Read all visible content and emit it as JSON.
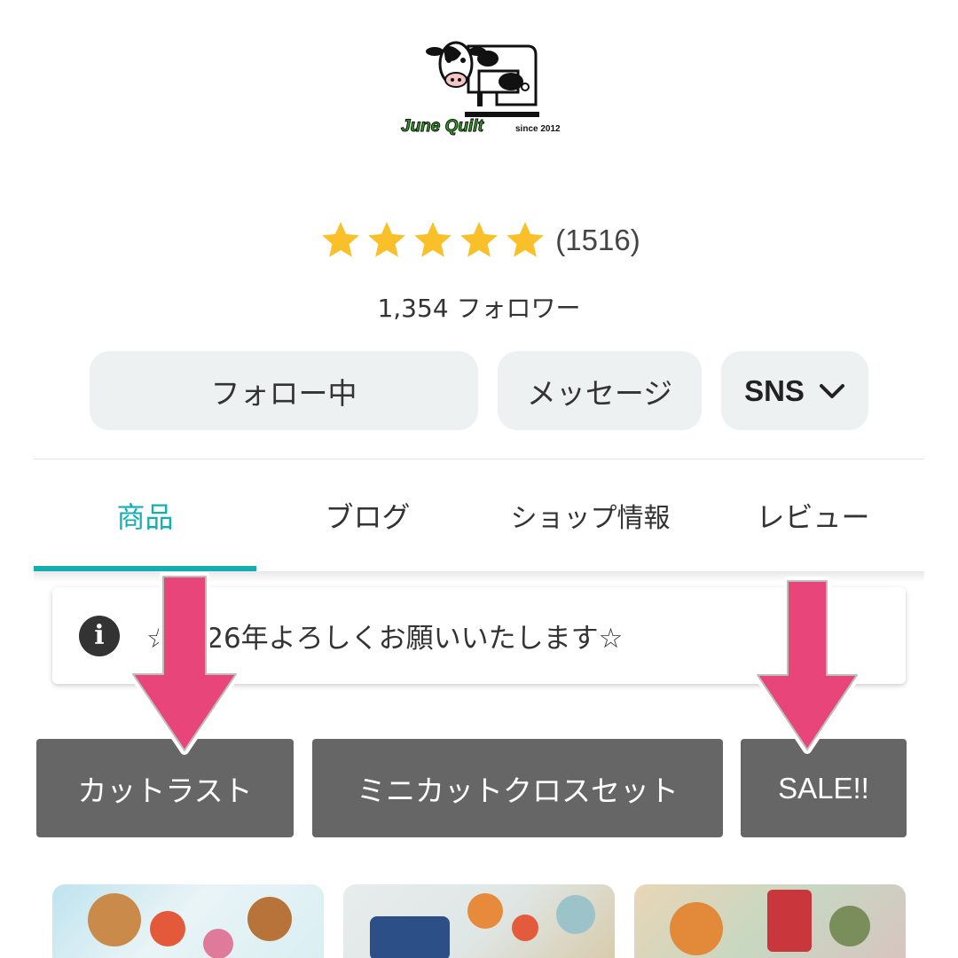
{
  "shop": {
    "logo_title": "June Quilt",
    "logo_since": "since 2012",
    "rating_stars": 5,
    "rating_count": "(1516)",
    "followers": "1,354 フォロワー"
  },
  "actions": {
    "follow_label": "フォロー中",
    "message_label": "メッセージ",
    "sns_label": "SNS"
  },
  "tabs": [
    {
      "label": "商品",
      "active": true
    },
    {
      "label": "ブログ",
      "active": false
    },
    {
      "label": "ショップ情報",
      "active": false
    },
    {
      "label": "レビュー",
      "active": false
    }
  ],
  "notice": {
    "text": "☆2026年よろしくお願いいたします☆"
  },
  "categories": [
    {
      "label": "カットラスト"
    },
    {
      "label": "ミニカットクロスセット"
    },
    {
      "label": "SALE!!"
    }
  ],
  "colors": {
    "accent": "#14aeb1",
    "star": "#f9c02a",
    "category_bg": "#666666",
    "arrow": "#e8457a",
    "logo_green": "#2fa31f"
  }
}
